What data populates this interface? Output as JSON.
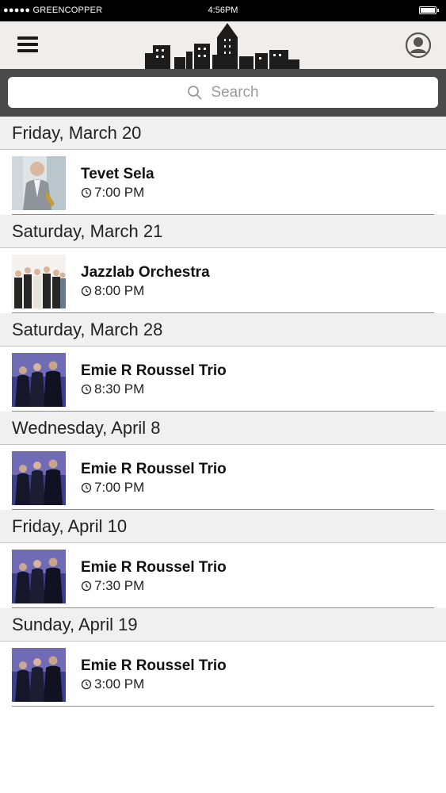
{
  "status_bar": {
    "carrier": "●●●●● GREENCOPPER",
    "time": "4:56PM"
  },
  "header": {
    "menu_icon": "hamburger-menu-icon",
    "logo": "city-skyline-logo",
    "profile_icon": "user-profile-icon"
  },
  "search": {
    "placeholder": "Search",
    "icon": "search-icon"
  },
  "events": [
    {
      "date": "Friday, March 20",
      "title": "Tevet Sela",
      "time": "7:00 PM",
      "image": "saxophonist-photo"
    },
    {
      "date": "Saturday, March 21",
      "title": "Jazzlab Orchestra",
      "time": "8:00 PM",
      "image": "band-group-photo"
    },
    {
      "date": "Saturday, March 28",
      "title": "Emie R Roussel Trio",
      "time": "8:30 PM",
      "image": "trio-photo"
    },
    {
      "date": "Wednesday, April 8",
      "title": "Emie R Roussel Trio",
      "time": "7:00 PM",
      "image": "trio-photo"
    },
    {
      "date": "Friday, April 10",
      "title": "Emie R Roussel Trio",
      "time": "7:30 PM",
      "image": "trio-photo"
    },
    {
      "date": "Sunday, April 19",
      "title": "Emie R Roussel Trio",
      "time": "3:00 PM",
      "image": "trio-photo"
    }
  ]
}
